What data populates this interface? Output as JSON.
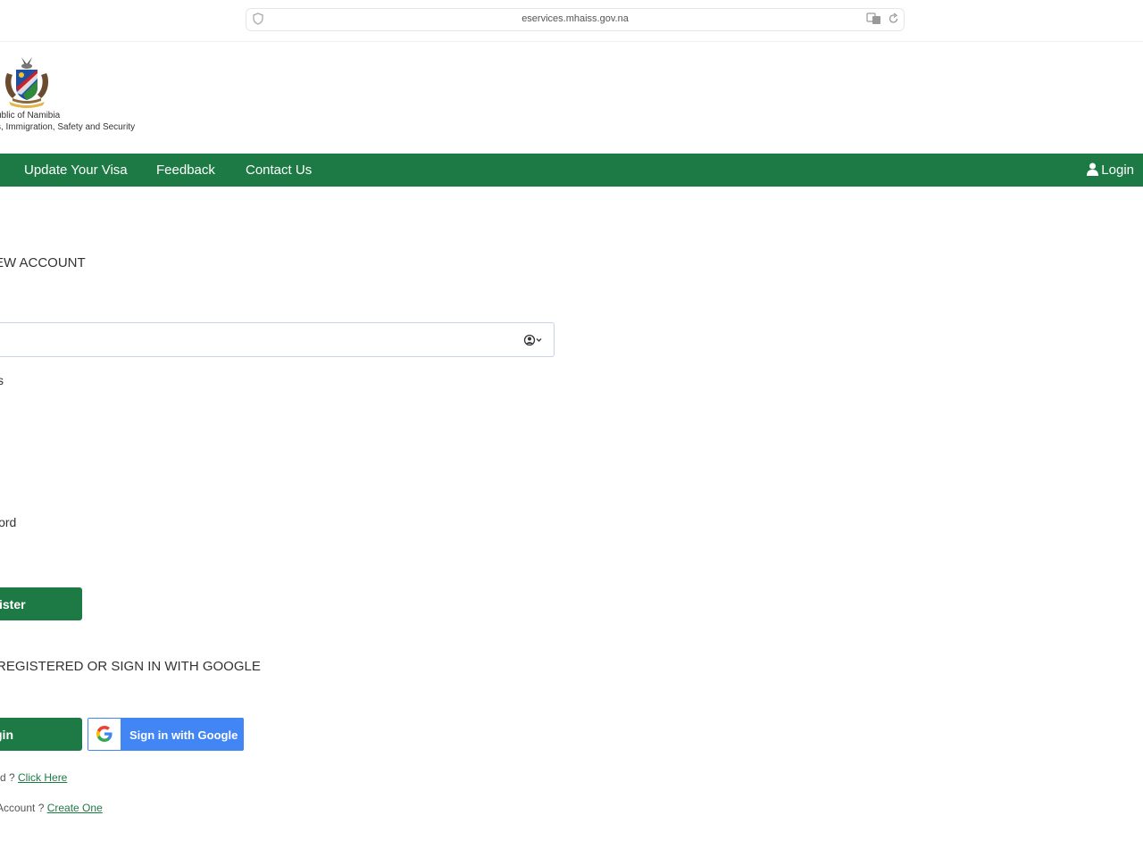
{
  "browser": {
    "url": "eservices.mhaiss.gov.na"
  },
  "header": {
    "org_line1": "ublic of Namibia",
    "org_line2": "s, Immigration, Safety and Security"
  },
  "nav": {
    "items": [
      {
        "label": "Update Your Visa"
      },
      {
        "label": "Feedback"
      },
      {
        "label": "Contact Us"
      }
    ],
    "login_label": "Login"
  },
  "form": {
    "heading": "EW ACCOUNT",
    "email_value": "",
    "email_label": "ss",
    "password_label": "word",
    "register_label": "ister"
  },
  "signin": {
    "heading": "REGISTERED OR SIGN IN WITH GOOGLE",
    "login_label": "gin",
    "google_label": "Sign in with Google",
    "forgot_prefix": "rd ? ",
    "forgot_link": "Click Here",
    "create_prefix": "Account ? ",
    "create_link": "Create One"
  },
  "colors": {
    "brand_green": "#1e7a45",
    "google_blue": "#4285f4"
  }
}
